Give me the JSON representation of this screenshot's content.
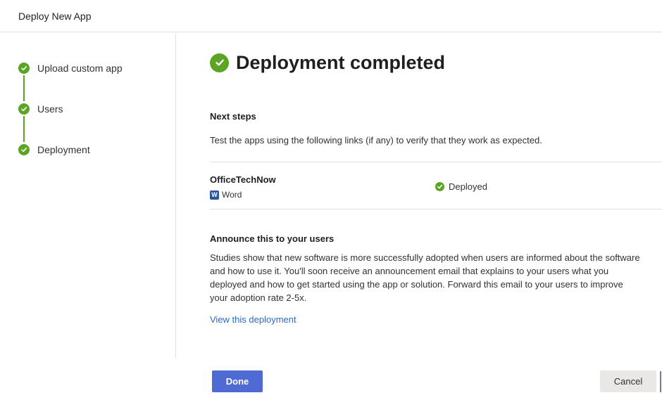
{
  "header": {
    "title": "Deploy New App"
  },
  "steps": [
    {
      "label": "Upload custom app",
      "status": "complete"
    },
    {
      "label": "Users",
      "status": "complete"
    },
    {
      "label": "Deployment",
      "status": "complete"
    }
  ],
  "main": {
    "heading": "Deployment completed",
    "next_steps": {
      "title": "Next steps",
      "text": "Test the apps using the following links (if any) to verify that they work as expected."
    },
    "apps": [
      {
        "name": "OfficeTechNow",
        "host": "Word",
        "host_icon": "word-icon",
        "status": "Deployed"
      }
    ],
    "announce": {
      "title": "Announce this to your users",
      "lines": [
        "Studies show that new software is more successfully adopted when users are informed about the software",
        "and how to use it. You'll soon receive an announcement email that explains to your users what you",
        "deployed and how to get started using the app or solution. Forward this email to your users to improve",
        "your adoption rate 2-5x."
      ]
    },
    "link_label": "View this deployment"
  },
  "footer": {
    "done_label": "Done",
    "cancel_label": "Cancel"
  },
  "colors": {
    "success": "#5ca424",
    "primary": "#4f6bd3",
    "link": "#2b6cc4",
    "word": "#2b579a"
  }
}
